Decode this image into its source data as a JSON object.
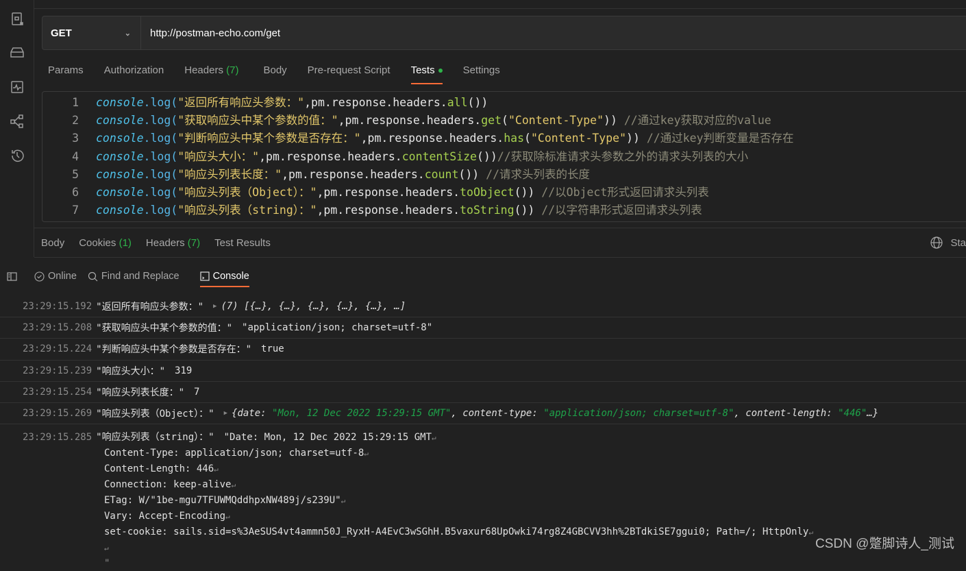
{
  "request": {
    "method": "GET",
    "url": "http://postman-echo.com/get"
  },
  "request_tabs": [
    {
      "label": "Params"
    },
    {
      "label": "Authorization"
    },
    {
      "label": "Headers",
      "count": "(7)"
    },
    {
      "label": "Body"
    },
    {
      "label": "Pre-request Script"
    },
    {
      "label": "Tests",
      "active": true
    }
  ],
  "code_lines": [
    [
      [
        "con",
        "console"
      ],
      [
        "log",
        ".log("
      ],
      [
        "str",
        "\"返回所有响应头参数：\""
      ],
      [
        "id",
        ",pm.response.headers."
      ],
      [
        "fn",
        "all"
      ],
      [
        "id",
        "())"
      ]
    ],
    [
      [
        "con",
        "console"
      ],
      [
        "log",
        ".log("
      ],
      [
        "str",
        "\"获取响应头中某个参数的值：\""
      ],
      [
        "id",
        ",pm.response.headers."
      ],
      [
        "fn",
        "get"
      ],
      [
        "id",
        "("
      ],
      [
        "str",
        "\"Content-Type\""
      ],
      [
        "id",
        "))"
      ],
      [
        "cm",
        " //通过key获取对应的value"
      ]
    ],
    [
      [
        "con",
        "console"
      ],
      [
        "log",
        ".log("
      ],
      [
        "str",
        "\"判断响应头中某个参数是否存在：\""
      ],
      [
        "id",
        ",pm.response.headers."
      ],
      [
        "fn",
        "has"
      ],
      [
        "id",
        "("
      ],
      [
        "str",
        "\"Content-Type\""
      ],
      [
        "id",
        "))"
      ],
      [
        "cm",
        " //通过key判断变量是否存在"
      ]
    ],
    [
      [
        "con",
        "console"
      ],
      [
        "log",
        ".log("
      ],
      [
        "str",
        "\"响应头大小：\""
      ],
      [
        "id",
        ",pm.response.headers."
      ],
      [
        "fn",
        "contentSize"
      ],
      [
        "id",
        "())"
      ],
      [
        "cm",
        "//获取除标准请求头参数之外的请求头列表的大小"
      ]
    ],
    [
      [
        "con",
        "console"
      ],
      [
        "log",
        ".log("
      ],
      [
        "str",
        "\"响应头列表长度：\""
      ],
      [
        "id",
        ",pm.response.headers."
      ],
      [
        "fn",
        "count"
      ],
      [
        "id",
        "())"
      ],
      [
        "cm",
        " //请求头列表的长度"
      ]
    ],
    [
      [
        "con",
        "console"
      ],
      [
        "log",
        ".log("
      ],
      [
        "str",
        "\"响应头列表（Object）：\""
      ],
      [
        "id",
        ",pm.response.headers."
      ],
      [
        "fn",
        "toObject"
      ],
      [
        "id",
        "())"
      ],
      [
        "cm",
        " //以Object形式返回请求头列表"
      ]
    ],
    [
      [
        "con",
        "console"
      ],
      [
        "log",
        ".log("
      ],
      [
        "str",
        "\"响应头列表（string）：\""
      ],
      [
        "id",
        ",pm.response.headers."
      ],
      [
        "fn",
        "toString"
      ],
      [
        "id",
        "())"
      ],
      [
        "cm",
        " //以字符串形式返回请求头列表"
      ]
    ]
  ],
  "response_tabs": {
    "body": "Body",
    "cookies": "Cookies",
    "cookies_count": "(1)",
    "headers": "Headers",
    "headers_count": "(7)",
    "test_results": "Test Results",
    "status": "Sta"
  },
  "console_toolbar": {
    "online": "Online",
    "find": "Find and Replace",
    "console": "Console"
  },
  "console_rows": [
    {
      "time": "23:29:15.192",
      "msg": "\"返回所有响应头参数：\"",
      "value": "(7) [{…}, {…}, {…}, {…}, {…}, …]",
      "type": "array"
    },
    {
      "time": "23:29:15.208",
      "msg": "\"获取响应头中某个参数的值：\"",
      "value": "\"application/json; charset=utf-8\""
    },
    {
      "time": "23:29:15.224",
      "msg": "\"判断响应头中某个参数是否存在：\"",
      "value": "true"
    },
    {
      "time": "23:29:15.239",
      "msg": "\"响应头大小：\"",
      "value": "319"
    },
    {
      "time": "23:29:15.254",
      "msg": "\"响应头列表长度：\"",
      "value": "7"
    },
    {
      "time": "23:29:15.269",
      "msg": "\"响应头列表（Object）：\"",
      "obj": {
        "k1": "date:",
        "v1": "\"Mon, 12 Dec 2022 15:29:15 GMT\"",
        "k2": "content-type:",
        "v2": "\"application/json; charset=utf-8\"",
        "k3": "content-length:",
        "v3": "\"446\"",
        "end": "…}"
      }
    }
  ],
  "string_row": {
    "time": "23:29:15.285",
    "msg": "\"响应头列表（string）：\"",
    "lines": [
      "\"Date: Mon, 12 Dec 2022 15:29:15 GMT",
      "Content-Type: application/json; charset=utf-8",
      "Content-Length: 446",
      "Connection: keep-alive",
      "ETag: W/\"1be-mgu7TFUWMQddhpxNW489j/s239U\"",
      "Vary: Accept-Encoding",
      "set-cookie: sails.sid=s%3AeSUS4vt4ammn50J_RyxH-A4EvC3wSGhH.B5vaxur68UpOwki74rg8Z4GBCVV3hh%2BTdkiSE7ggui0; Path=/; HttpOnly",
      ""
    ],
    "closing": "\""
  },
  "watermark": "CSDN @蹩脚诗人_测试"
}
